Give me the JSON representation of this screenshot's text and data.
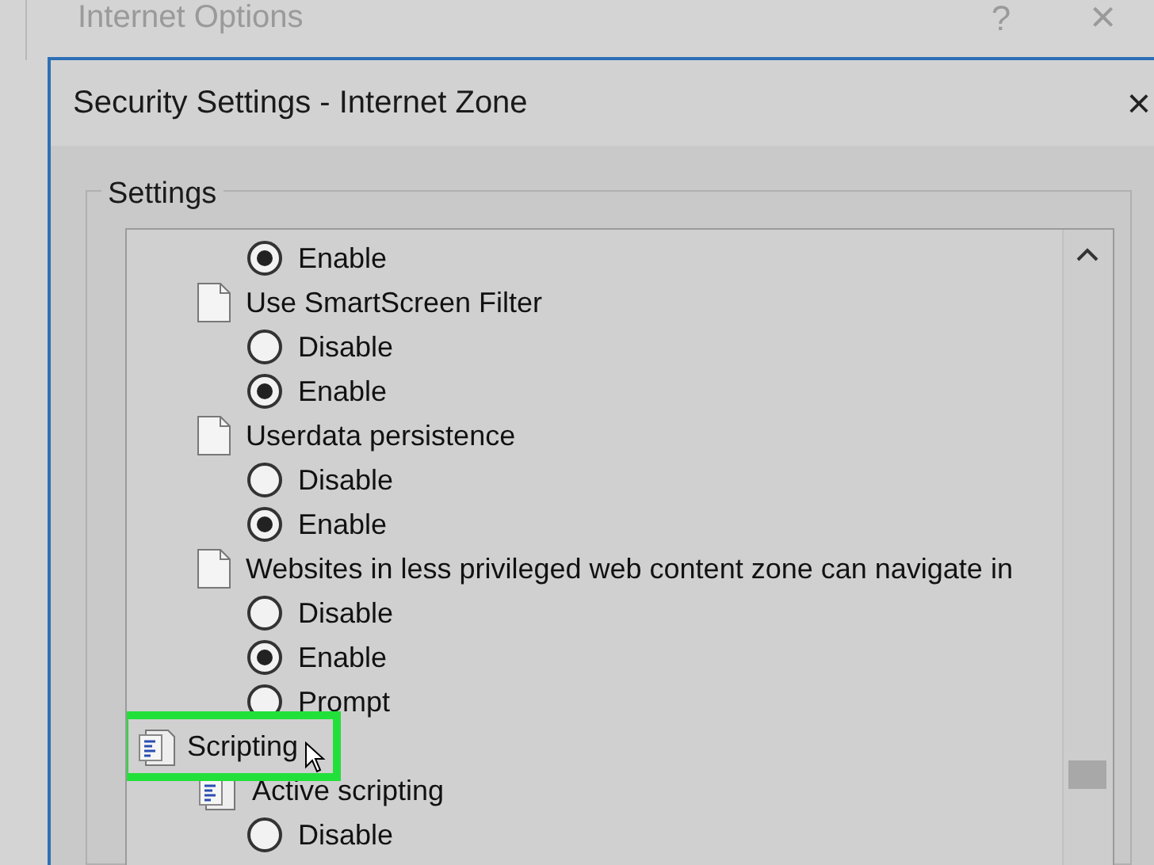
{
  "back_window": {
    "title": "Internet Options",
    "help": "?",
    "close": "×"
  },
  "dialog": {
    "title": "Security Settings - Internet Zone",
    "close": "×",
    "group_label": "Settings",
    "items": [
      {
        "kind": "option",
        "label": "Enable",
        "selected": true
      },
      {
        "kind": "setting",
        "label": "Use SmartScreen Filter",
        "children": [
          {
            "kind": "option",
            "label": "Disable",
            "selected": false
          },
          {
            "kind": "option",
            "label": "Enable",
            "selected": true
          }
        ]
      },
      {
        "kind": "setting",
        "label": "Userdata persistence",
        "children": [
          {
            "kind": "option",
            "label": "Disable",
            "selected": false
          },
          {
            "kind": "option",
            "label": "Enable",
            "selected": true
          }
        ]
      },
      {
        "kind": "setting",
        "label": "Websites in less privileged web content zone can navigate in",
        "children": [
          {
            "kind": "option",
            "label": "Disable",
            "selected": false
          },
          {
            "kind": "option",
            "label": "Enable",
            "selected": true
          },
          {
            "kind": "option",
            "label": "Prompt",
            "selected": false
          }
        ]
      },
      {
        "kind": "category",
        "label": "Scripting",
        "highlighted": true,
        "children": [
          {
            "kind": "script-setting",
            "label": "Active scripting",
            "children": [
              {
                "kind": "option",
                "label": "Disable",
                "selected": false
              }
            ]
          }
        ]
      }
    ]
  }
}
